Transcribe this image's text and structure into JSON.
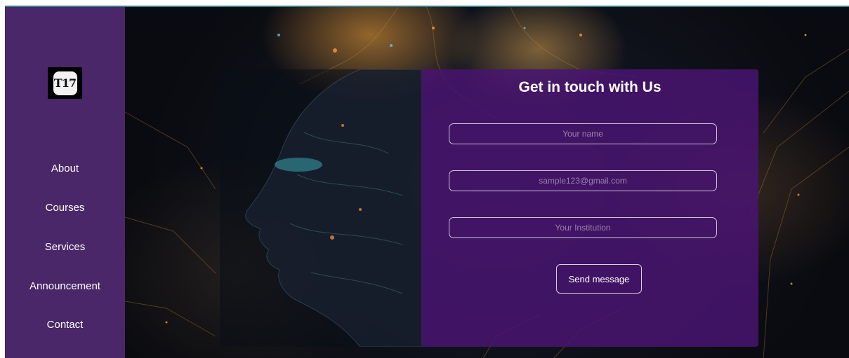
{
  "brand": {
    "logo_text": "T17"
  },
  "sidebar": {
    "items": [
      {
        "label": "About"
      },
      {
        "label": "Courses"
      },
      {
        "label": "Services"
      },
      {
        "label": "Announcement"
      },
      {
        "label": "Contact"
      }
    ]
  },
  "contact_form": {
    "title": "Get in touch with Us",
    "name_placeholder": "Your name",
    "email_placeholder": "sample123@gmail.com",
    "institution_placeholder": "Your Institution",
    "send_label": "Send message"
  },
  "colors": {
    "sidebar_bg": "#4a2768",
    "panel_bg": "#481470",
    "accent_border": "#2f7f8c"
  },
  "icons": {
    "logo": "t17-logo-icon"
  }
}
